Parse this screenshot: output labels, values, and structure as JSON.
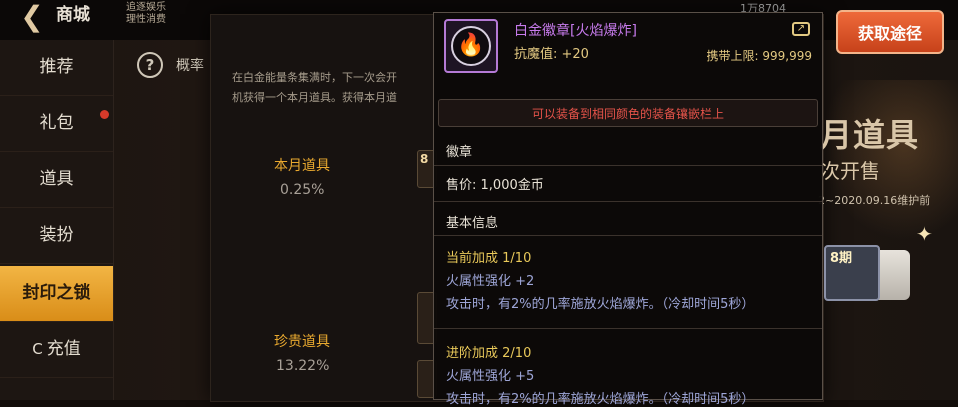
{
  "topbar": {
    "back_glyph": "❮",
    "title": "商城",
    "tag_line1": "追逐娱乐",
    "tag_line2": "理性消费",
    "currency_text": "1万8704"
  },
  "sidebar": {
    "items": [
      {
        "label": "推荐"
      },
      {
        "label": "礼包"
      },
      {
        "label": "道具"
      },
      {
        "label": "装扮"
      },
      {
        "label": "封印之锁"
      },
      {
        "label": "充值",
        "icon": "C"
      }
    ]
  },
  "help": {
    "icon": "?",
    "text": "概率"
  },
  "modal": {
    "desc_line1": "在白金能量条集满时，下一次会开",
    "desc_line2": "机获得一个本月道具。获得本月道",
    "rows": [
      {
        "label": "本月道具",
        "value": "0.25%"
      },
      {
        "label": "珍贵道具",
        "value": "13.22%"
      }
    ],
    "slot_num": "8"
  },
  "banner": {
    "title": "月道具",
    "subtitle": "次开售",
    "date": "2~2020.09.16维护前",
    "get_button": "获取途径",
    "reward_num": "8期"
  },
  "tooltip": {
    "icon_name": "flame-badge-icon",
    "item_name": "白金徽章[火焰爆炸]",
    "stat": "抗魔值: +20",
    "carry_limit": "携带上限: 999,999",
    "equip_note": "可以装备到相同颜色的装备镶嵌栏上",
    "category": "徽章",
    "price_label": "售价: ",
    "price_value": "1,000金币",
    "basic_info": "基本信息",
    "current_bonus_label": "当前加成",
    "current_bonus_level": "1/10",
    "current_fire": "火属性强化 +2",
    "current_effect": "攻击时，有2%的几率施放火焰爆炸。（冷却时间5秒）",
    "advanced_bonus_label": "进阶加成",
    "advanced_bonus_level": "2/10",
    "advanced_fire": "火属性强化 +5",
    "advanced_effect": "攻击时，有2%的几率施放火焰爆炸。（冷却时间5秒）"
  },
  "colors": {
    "item_name": "#c77bec",
    "gold_text": "#e3c982",
    "red_note": "#e5534a",
    "active_tab": "#f2b544",
    "bonus_blue": "#9ea6d8"
  }
}
